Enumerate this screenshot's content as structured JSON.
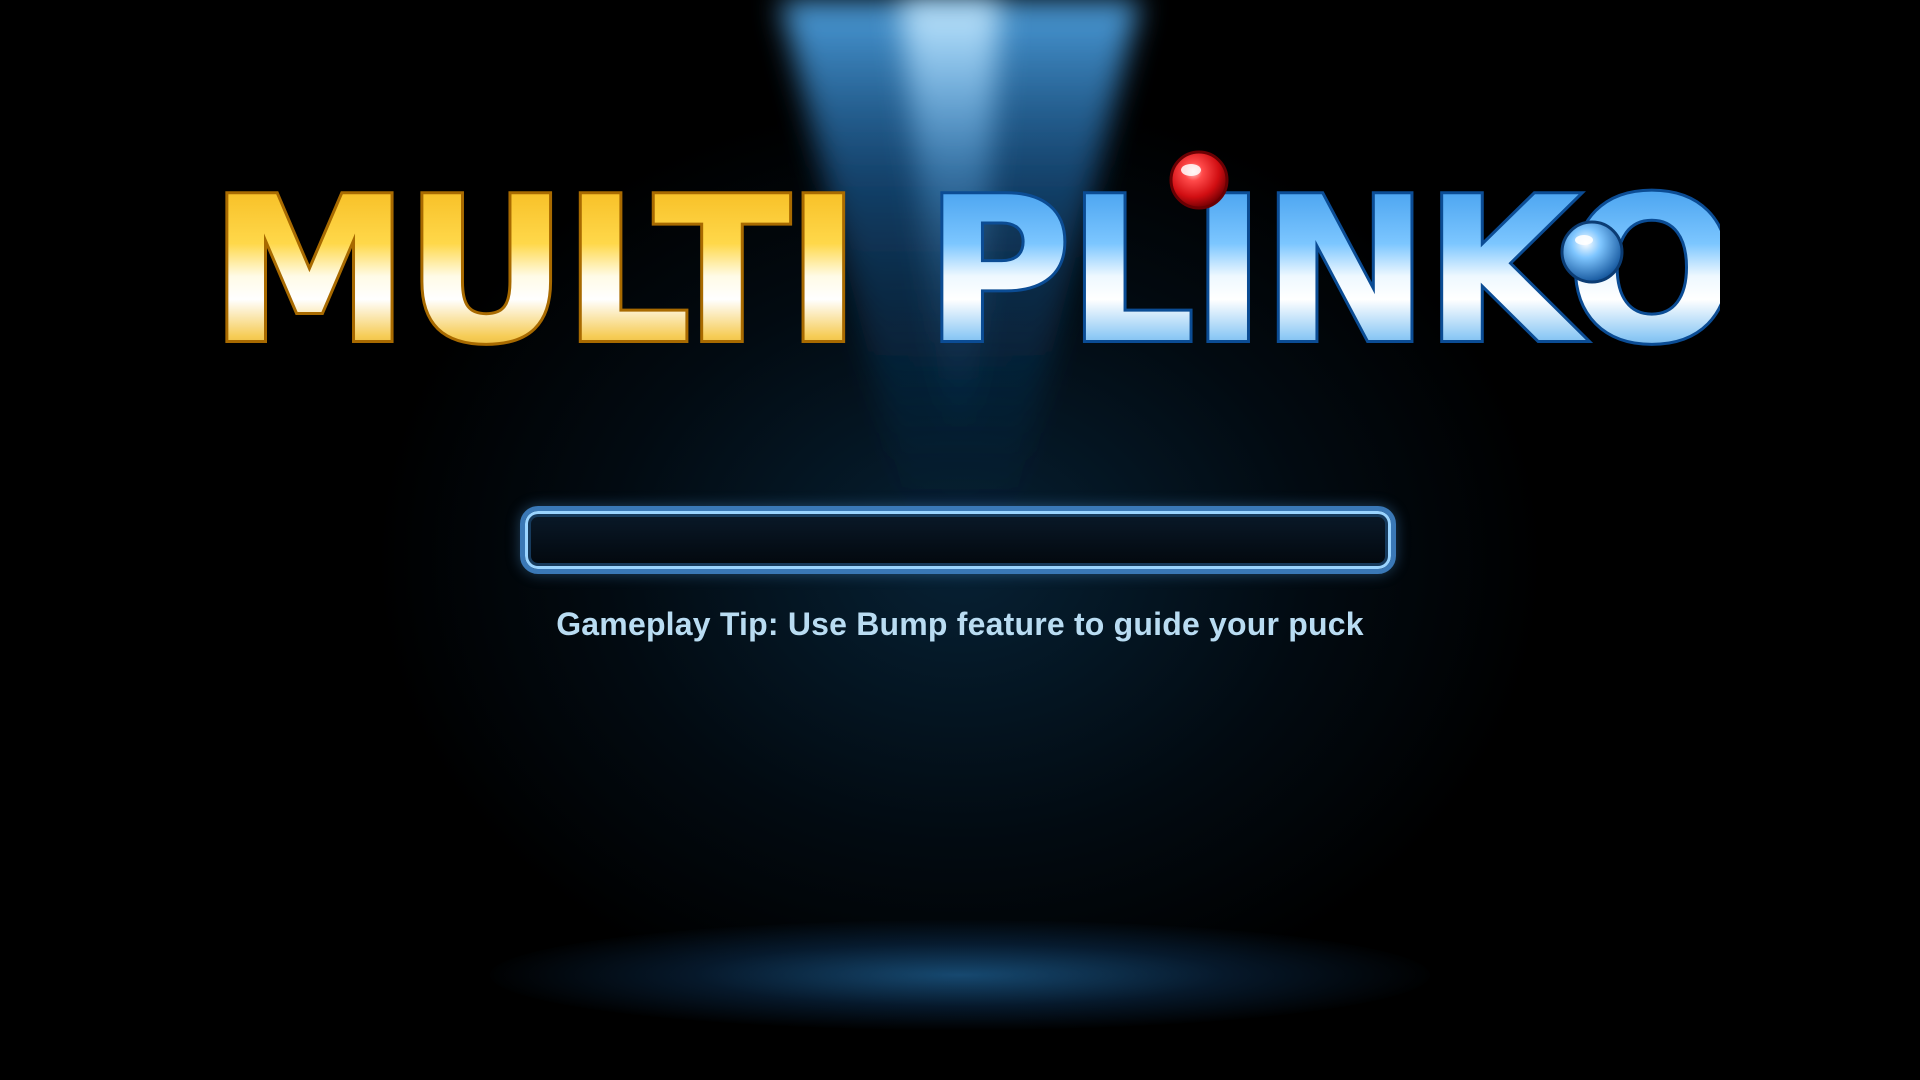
{
  "logo": {
    "text_left": "MULTI",
    "text_right": "PLINKO",
    "colors": {
      "gold_light": "#fff6c8",
      "gold": "#f4b71a",
      "gold_dark": "#a86a00",
      "blue_light": "#eef8ff",
      "blue": "#3d9ef0",
      "blue_dark": "#0b4c94",
      "ball_red": "#e8161a"
    }
  },
  "loading": {
    "progress": 0
  },
  "tip": {
    "text": "Gameplay Tip: Use Bump feature to guide your puck"
  },
  "colors": {
    "background": "#000000",
    "spotlight": "#3aa0f0",
    "tip_text": "#b9dcf2",
    "bar_border": "#3a78b6"
  }
}
